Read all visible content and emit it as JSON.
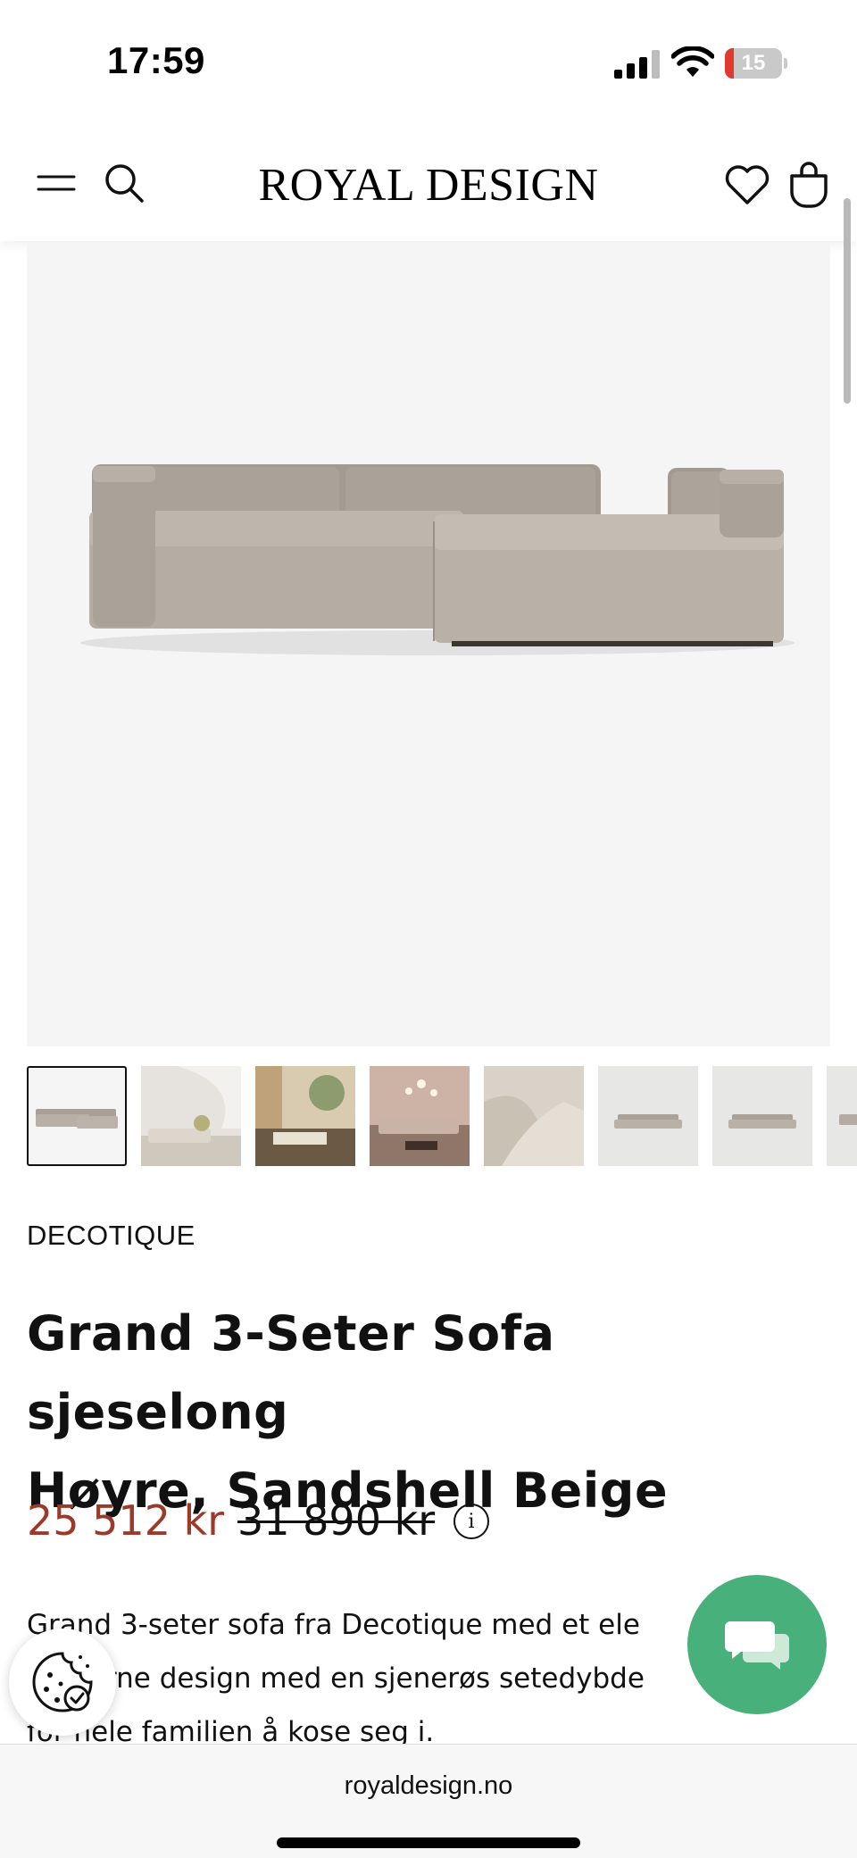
{
  "status_bar": {
    "time": "17:59",
    "battery_level": "15",
    "battery_fraction": 0.15,
    "battery_color": "#e03a2e"
  },
  "header": {
    "logo": "ROYAL DESIGN",
    "icons": [
      "menu-icon",
      "search-icon",
      "heart-icon",
      "shopping-bag-icon"
    ]
  },
  "gallery": {
    "main_image": "sofa-chaise-image",
    "thumbnail_count": 8,
    "thumbnails": [
      "sofa-product-image",
      "living-room-photo",
      "living-room-photo",
      "living-room-photo",
      "fabric-detail-photo",
      "sofa-product-image",
      "sofa-product-image",
      "sofa-product-image"
    ]
  },
  "product": {
    "brand": "DECOTIQUE",
    "title_line1": "Grand 3-Seter Sofa sjeselong",
    "title_line2": "Høyre, Sandshell Beige",
    "price": "25 512 kr",
    "old_price": "31 890 kr",
    "info_icon_label": "i",
    "description": [
      "Grand 3-seter sofa fra Decotique med et ele",
      "moderne design med en sjenerøs setedybde",
      "for hele familien å kose seg i."
    ]
  },
  "floating": {
    "chat_icon": "chat-bubbles-icon",
    "cookie_icon": "cookie-icon"
  },
  "colors": {
    "accent_price": "#9c3a2a",
    "chat_green": "#48b07a"
  },
  "browser": {
    "url": "royaldesign.no"
  }
}
